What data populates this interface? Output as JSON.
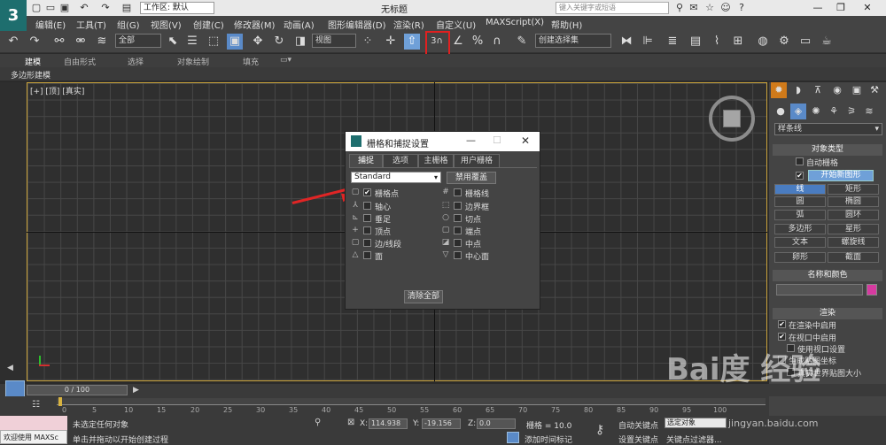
{
  "title_bar": {
    "workspace": "工作区: 默认",
    "window_title": "无标题",
    "search_placeholder": "键入关键字或短语"
  },
  "menu": [
    "编辑(E)",
    "工具(T)",
    "组(G)",
    "视图(V)",
    "创建(C)",
    "修改器(M)",
    "动画(A)",
    "图形编辑器(D)",
    "渲染(R)",
    "自定义(U)",
    "MAXScript(X)",
    "帮助(H)"
  ],
  "toolbar": {
    "selection_filter": "全部",
    "ref_coord": "视图",
    "snap_label": "3",
    "named_sel_set": "创建选择集"
  },
  "ribbon": {
    "tabs": [
      "建模",
      "自由形式",
      "选择",
      "对象绘制",
      "填充"
    ],
    "sub_label": "多边形建模"
  },
  "viewport": {
    "label": "[+] [顶] [真实]"
  },
  "dialog": {
    "title": "栅格和捕捉设置",
    "tabs": [
      "捕捉",
      "选项",
      "主栅格",
      "用户栅格"
    ],
    "dropdown": "Standard",
    "override_button": "禁用覆盖",
    "left_options": [
      {
        "label": "栅格点",
        "checked": true
      },
      {
        "label": "轴心",
        "checked": false
      },
      {
        "label": "垂足",
        "checked": false
      },
      {
        "label": "顶点",
        "checked": false
      },
      {
        "label": "边/线段",
        "checked": false
      },
      {
        "label": "面",
        "checked": false
      }
    ],
    "right_options": [
      {
        "label": "栅格线",
        "checked": false
      },
      {
        "label": "边界框",
        "checked": false
      },
      {
        "label": "切点",
        "checked": false
      },
      {
        "label": "端点",
        "checked": false
      },
      {
        "label": "中点",
        "checked": false
      },
      {
        "label": "中心面",
        "checked": false
      }
    ],
    "clear_button": "清除全部"
  },
  "cmd_panel": {
    "category": "样条线",
    "object_type_header": "对象类型",
    "auto_grid": "自动栅格",
    "start_new_shape": "开始新图形",
    "objects": [
      "线",
      "矩形",
      "圆",
      "椭圆",
      "弧",
      "圆环",
      "多边形",
      "星形",
      "文本",
      "螺旋线",
      "卵形",
      "截面"
    ],
    "name_color_header": "名称和颜色",
    "render_header": "渲染",
    "render_opts": [
      "在渲染中启用",
      "在视口中启用",
      "使用视口设置",
      "生成贴图坐标",
      "真实世界贴图大小"
    ],
    "color_swatch": "#d63aa0"
  },
  "timeline": {
    "frame": "0 / 100",
    "ticks": [
      "0",
      "5",
      "10",
      "15",
      "20",
      "25",
      "30",
      "35",
      "40",
      "45",
      "50",
      "55",
      "60",
      "65",
      "70",
      "75",
      "80",
      "85",
      "90",
      "95",
      "100"
    ]
  },
  "status": {
    "welcome": "欢迎使用 MAXSc",
    "line1": "未选定任何对象",
    "line2": "单击并拖动以开始创建过程",
    "x_label": "X:",
    "x_value": "114.938",
    "y_label": "Y:",
    "y_value": "-19.156",
    "z_label": "Z:",
    "z_value": "0.0",
    "grid": "栅格 = 10.0",
    "auto_key": "自动关键点",
    "selected": "选定对象",
    "set_key": "设置关键点",
    "key_filter": "关键点过滤器...",
    "add_time_tag": "添加时间标记"
  },
  "watermark": {
    "brand": "Bai度 经验",
    "url": "jingyan.baidu.com"
  }
}
